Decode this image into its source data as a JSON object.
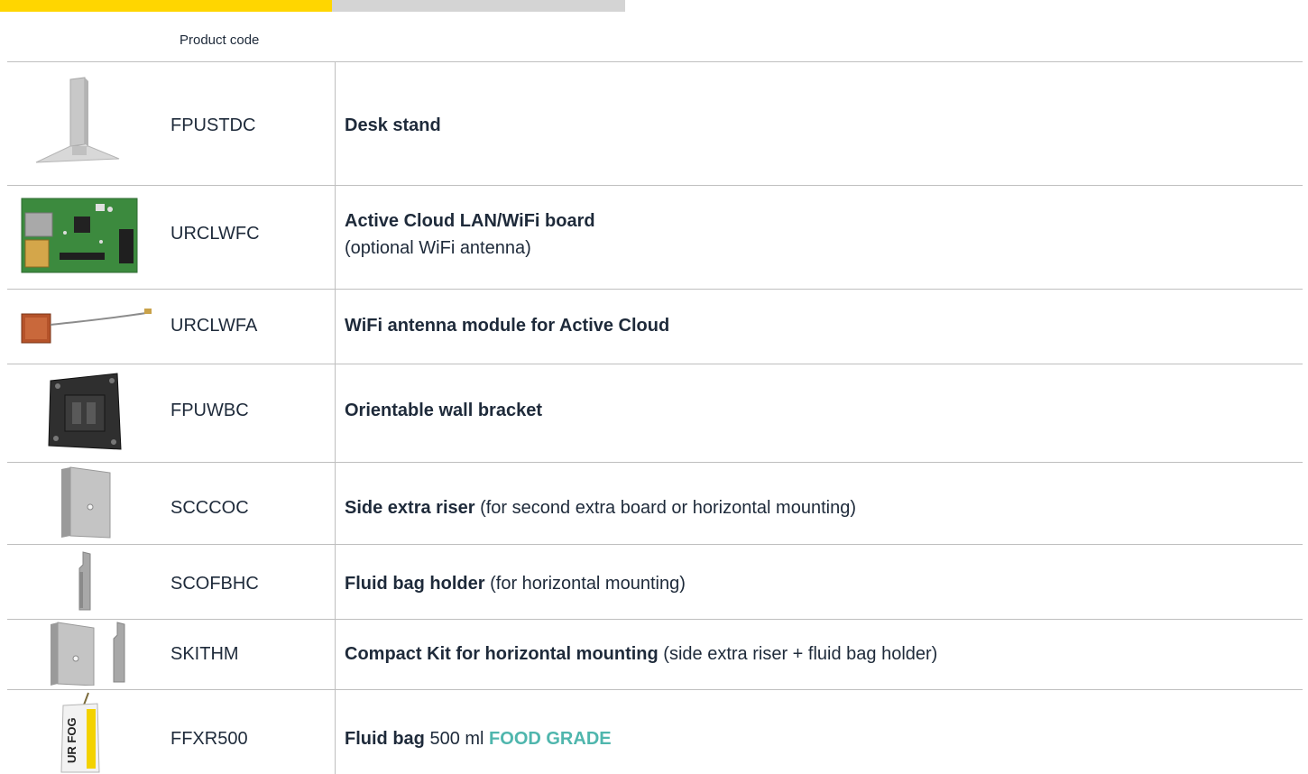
{
  "header": {
    "bar_colors": {
      "accent": "#ffd600",
      "neutral": "#d4d4d4"
    },
    "column_label": "Product code"
  },
  "rows": [
    {
      "image": "desk-stand-image",
      "code": "FPUSTDC",
      "title": "Desk stand",
      "detail": ""
    },
    {
      "image": "lan-wifi-board-image",
      "code": "URCLWFC",
      "title": "Active Cloud LAN/WiFi board",
      "detail": "(optional WiFi antenna)"
    },
    {
      "image": "wifi-antenna-image",
      "code": "URCLWFA",
      "title": "WiFi antenna module for Active Cloud",
      "detail": ""
    },
    {
      "image": "wall-bracket-image",
      "code": "FPUWBC",
      "title": "Orientable wall bracket",
      "detail": ""
    },
    {
      "image": "side-riser-image",
      "code": "SCCCOC",
      "title": "Side extra riser",
      "detail": " (for second extra board or horizontal mounting)"
    },
    {
      "image": "fluid-bag-holder-image",
      "code": "SCOFBHC",
      "title": "Fluid bag holder",
      "detail": " (for horizontal mounting)"
    },
    {
      "image": "compact-kit-image",
      "code": "SKITHM",
      "title": "Compact Kit for horizontal mounting",
      "detail": " (side extra riser + fluid bag holder)"
    },
    {
      "image": "fluid-bag-image",
      "code": "FFXR500",
      "title": "Fluid bag",
      "detail": " 500 ml ",
      "badge": "FOOD GRADE",
      "badge_color": "#4fb6ad",
      "pack_text": "UR FOG"
    }
  ]
}
